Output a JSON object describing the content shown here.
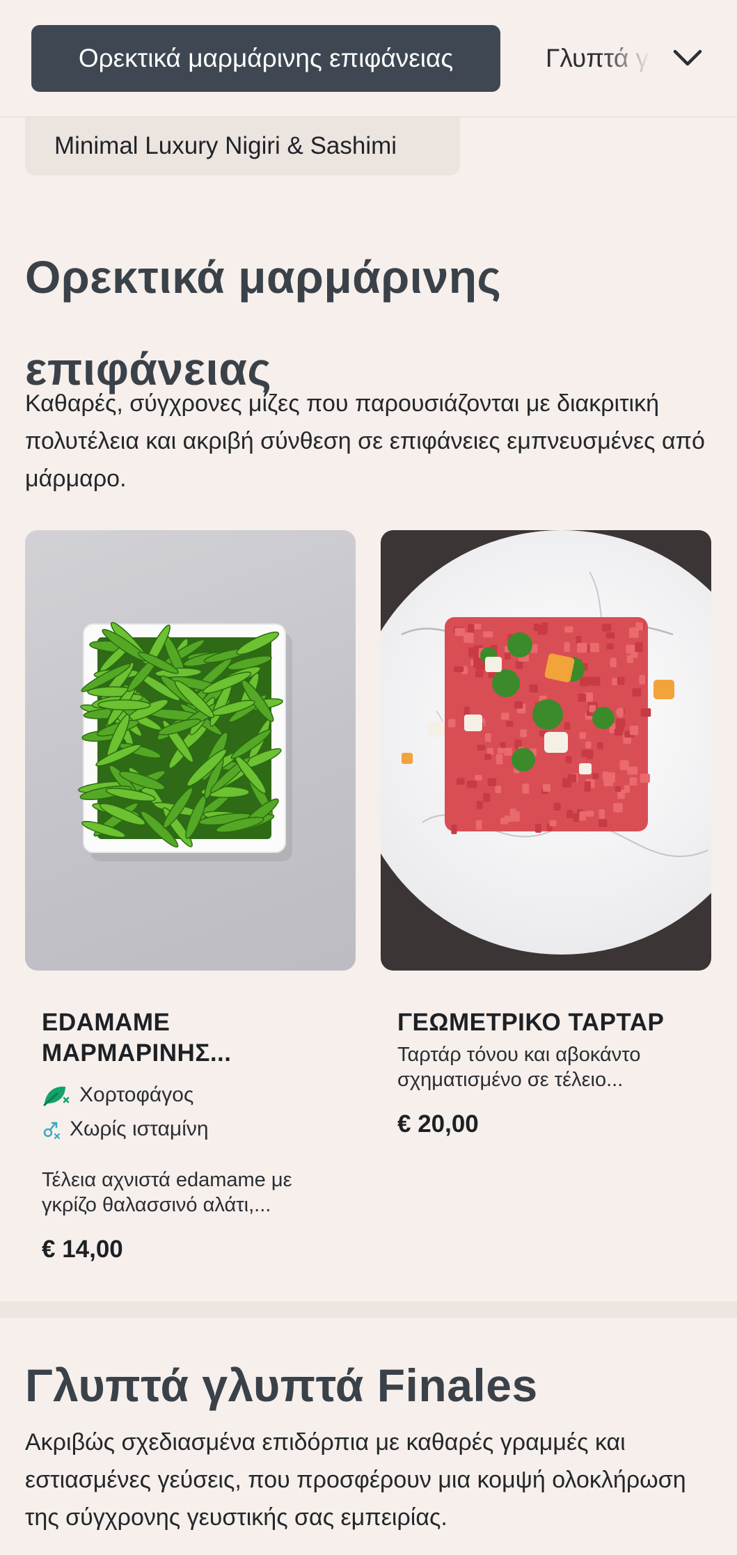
{
  "nav": {
    "active_tab": "Ορεκτικά μαρμάρινης επιφάνειας",
    "next_tab": "Γλυπτά γ",
    "chevron_icon": "chevron-down-icon",
    "subcategory": "Minimal Luxury Nigiri & Sashimi"
  },
  "section1": {
    "title": "Ορεκτικά μαρμάρινης επιφάνειας",
    "description": "Καθαρές, σύγχρονες μίζες που παρουσιάζονται με διακριτική πολυτέλεια και ακριβή σύνθεση σε επιφάνειες εμπνευσμένες από μάρμαρο."
  },
  "items": [
    {
      "name": "EDAMAME ΜΑΡΜΑΡΙΝΗΣ...",
      "tags": [
        {
          "label": "Χορτοφάγος",
          "icon": "leaf-icon",
          "color": "#12a36b"
        },
        {
          "label": "Χωρίς ισταμίνη",
          "icon": "histamine-free-icon",
          "color": "#3aa7c4"
        }
      ],
      "description": "Τέλεια αχνιστά edamame με γκρίζο θαλασσινό αλάτι,...",
      "price": "€ 14,00"
    },
    {
      "name": "ΓΕΩΜΕΤΡΙΚΟ ΤΑΡΤΑΡ",
      "tags": [],
      "description": "Ταρτάρ τόνου και αβοκάντο σχηματισμένο σε τέλειο...",
      "price": "€ 20,00"
    }
  ],
  "section2": {
    "title": "Γλυπτά γλυπτά Finales",
    "description": "Ακριβώς σχεδιασμένα επιδόρπια με καθαρές γραμμές και εστιασμένες γεύσεις, που προσφέρουν μια κομψή ολοκλήρωση της σύγχρονης γευστικής σας εμπειρίας."
  },
  "colors": {
    "background": "#f6efeb",
    "active_tab_bg": "#3f4852",
    "heading": "#3a4149"
  }
}
